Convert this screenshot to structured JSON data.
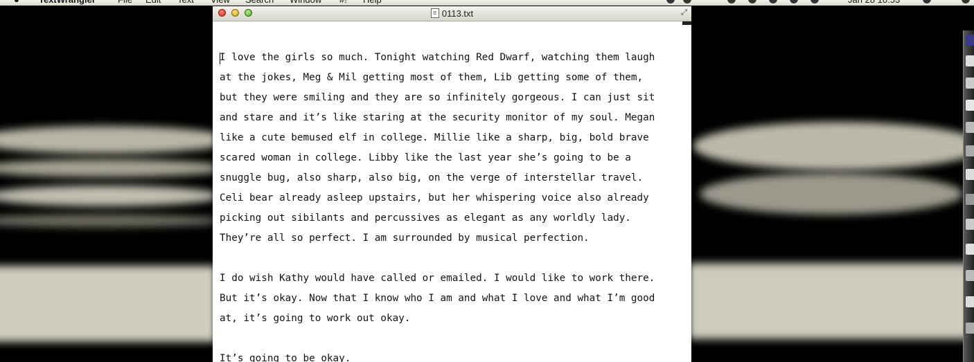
{
  "menubar": {
    "app_name": "TextWrangler",
    "items": [
      "File",
      "Edit",
      "Text",
      "View",
      "Search",
      "Window",
      "#!",
      "Help"
    ],
    "clock": "Jan 28  10:53"
  },
  "window": {
    "title": "0113.txt",
    "resize_glyph": "⤢"
  },
  "document": {
    "paragraphs": [
      [
        "I love the girls so much. Tonight watching Red Dwarf, watching them laugh",
        "at the jokes, Meg & Mil getting most of them, Lib getting some of them,",
        "but they were smiling and they are so infinitely gorgeous. I can just sit",
        "and stare and it’s like staring at the security monitor of my soul. Megan",
        "like a cute bemused elf in college. Millie like a sharp, big, bold brave",
        "scared woman in college. Libby like the last year she’s going to be a",
        "snuggle bug, also sharp, also big, on the verge of interstellar travel.",
        "Celi bear already asleep upstairs, but her whispering voice also already",
        "picking out sibilants and percussives as elegant as any worldly lady.",
        "They’re all so perfect. I am surrounded by musical perfection."
      ],
      [
        "I do wish Kathy would have called or emailed. I would like to work there.",
        "But it’s okay. Now that I know who I am and what I love and what I’m good",
        "at, it’s going to work out okay."
      ],
      [
        "It’s going to be okay."
      ]
    ]
  },
  "colors": {
    "window_bg": "#ffffff",
    "desktop_bg": "#000000",
    "close": "#d2261a",
    "minimize": "#c99a12",
    "zoom": "#4fa326"
  }
}
